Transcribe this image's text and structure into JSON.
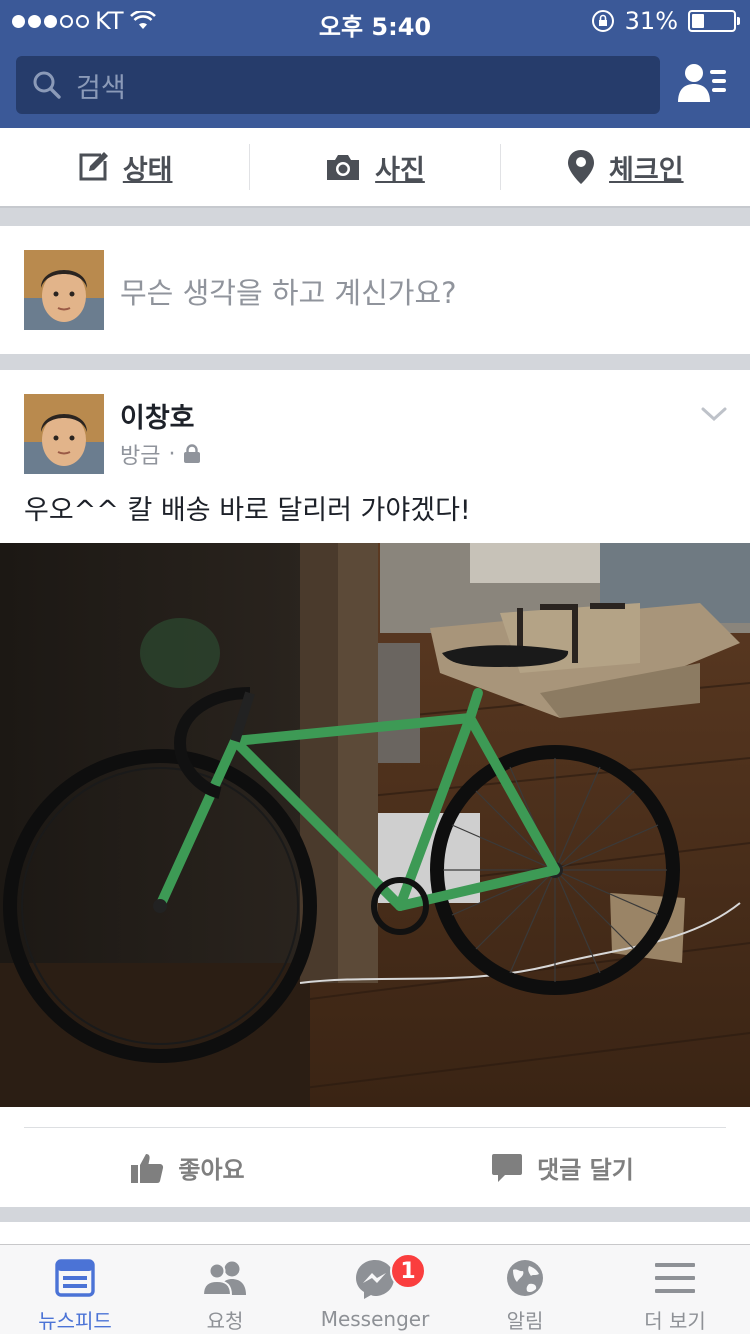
{
  "status_bar": {
    "carrier": "KT",
    "time": "오후 5:40",
    "battery_percent": "31%",
    "battery_level": 0.31
  },
  "search": {
    "placeholder": "검색"
  },
  "composer_actions": [
    {
      "label": "상태",
      "icon": "edit-icon"
    },
    {
      "label": "사진",
      "icon": "camera-icon"
    },
    {
      "label": "체크인",
      "icon": "location-pin-icon"
    }
  ],
  "composer": {
    "prompt": "무슨 생각을 하고 계신가요?"
  },
  "post": {
    "author": "이창호",
    "time": "방금",
    "privacy_icon": "lock-icon",
    "text": "우오^^ 칼 배송 바로 달리러 가야겠다!",
    "like_label": "좋아요",
    "comment_label": "댓글 달기"
  },
  "tabs": [
    {
      "label": "뉴스피드",
      "icon": "newsfeed-icon",
      "active": true
    },
    {
      "label": "요청",
      "icon": "friend-requests-icon"
    },
    {
      "label": "Messenger",
      "icon": "messenger-icon",
      "badge": "1"
    },
    {
      "label": "알림",
      "icon": "globe-icon"
    },
    {
      "label": "더 보기",
      "icon": "menu-icon"
    }
  ],
  "colors": {
    "header": "#3b5998",
    "search_bg": "#263c6b",
    "active_tab": "#4b73d6",
    "badge": "#fa3e3e"
  }
}
